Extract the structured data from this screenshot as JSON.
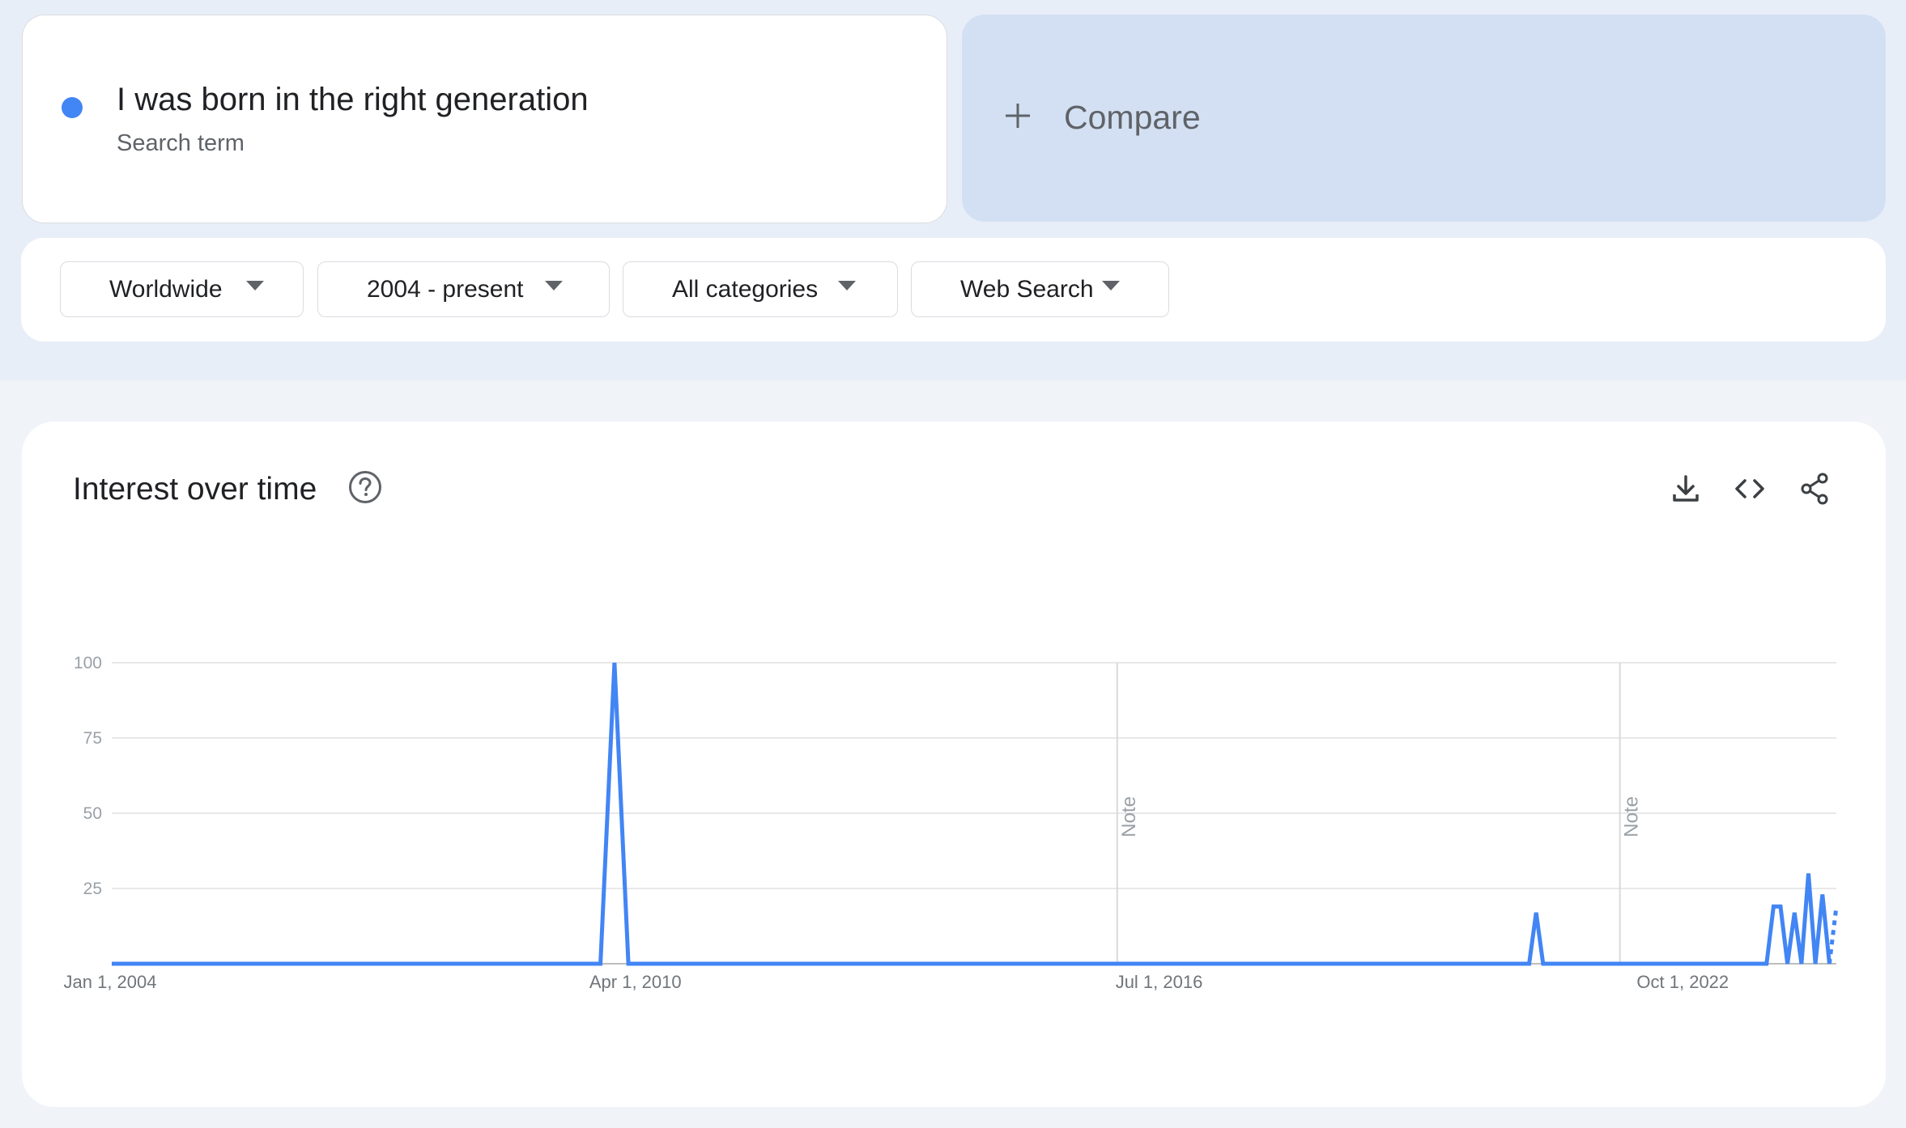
{
  "search_term": {
    "title": "I was born in the right generation",
    "subtitle": "Search term",
    "color": "#4285f4"
  },
  "compare": {
    "label": "Compare",
    "icon": "plus-icon"
  },
  "filters": [
    {
      "label": "Worldwide",
      "icon": "dropdown-caret-icon"
    },
    {
      "label": "2004 - present",
      "icon": "dropdown-caret-icon"
    },
    {
      "label": "All categories",
      "icon": "dropdown-caret-icon"
    },
    {
      "label": "Web Search",
      "icon": "dropdown-caret-icon"
    }
  ],
  "panel": {
    "title": "Interest over time",
    "help_icon": "help-icon",
    "actions": [
      "download-icon",
      "embed-code-icon",
      "share-icon"
    ]
  },
  "chart_data": {
    "type": "line",
    "title": "",
    "xlabel": "",
    "ylabel": "",
    "ylim": [
      0,
      100
    ],
    "y_ticks": [
      "100",
      "75",
      "50",
      "25"
    ],
    "x_ticks": [
      "Jan 1, 2004",
      "Apr 1, 2010",
      "Jul 1, 2016",
      "Oct 1, 2022"
    ],
    "x_range": [
      "2004-01",
      "2024-08"
    ],
    "grid": true,
    "legend": "none",
    "color": "#4285f4",
    "notes": [
      {
        "date": "2016-01",
        "label": "Note"
      },
      {
        "date": "2022-01",
        "label": "Note"
      }
    ],
    "series": [
      {
        "points": [
          {
            "x": "2004-01",
            "y": 0
          },
          {
            "x": "2009-11",
            "y": 0
          },
          {
            "x": "2010-01",
            "y": 100
          },
          {
            "x": "2010-03",
            "y": 0
          },
          {
            "x": "2020-12",
            "y": 0
          },
          {
            "x": "2021-01",
            "y": 17
          },
          {
            "x": "2021-02",
            "y": 0
          },
          {
            "x": "2023-10",
            "y": 0
          },
          {
            "x": "2023-11",
            "y": 19
          },
          {
            "x": "2023-12",
            "y": 19
          },
          {
            "x": "2024-01",
            "y": 0
          },
          {
            "x": "2024-02",
            "y": 17
          },
          {
            "x": "2024-03",
            "y": 0
          },
          {
            "x": "2024-04",
            "y": 30
          },
          {
            "x": "2024-05",
            "y": 0
          },
          {
            "x": "2024-06",
            "y": 23
          },
          {
            "x": "2024-07",
            "y": 0
          }
        ],
        "partial_points": [
          {
            "x": "2024-07",
            "y": 0
          },
          {
            "x": "2024-08",
            "y": 19
          }
        ]
      }
    ]
  }
}
